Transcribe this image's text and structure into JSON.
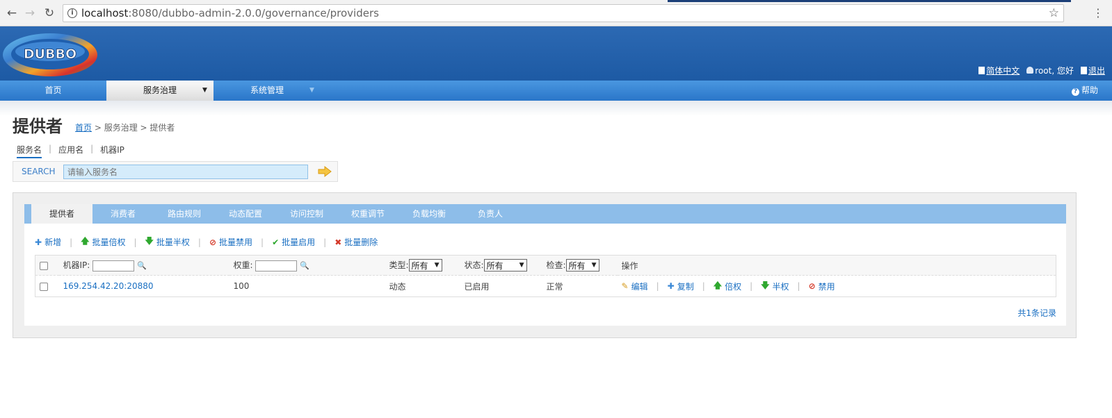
{
  "browser": {
    "url_host": "localhost",
    "url_rest": ":8080/dubbo-admin-2.0.0/governance/providers"
  },
  "header": {
    "logo_text": "DUBBO",
    "lang_label": "简体中文",
    "greeting": "root, 您好",
    "logout_label": "退出",
    "help_label": "帮助"
  },
  "nav": {
    "items": [
      "首页",
      "服务治理",
      "系统管理"
    ]
  },
  "page": {
    "title": "提供者",
    "breadcrumb": {
      "home": "首页",
      "rest": " > 服务治理 > 提供者"
    }
  },
  "search": {
    "tabs": [
      "服务名",
      "应用名",
      "机器IP"
    ],
    "label": "SEARCH",
    "placeholder": "请输入服务名"
  },
  "subtabs": [
    "提供者",
    "消费者",
    "路由规则",
    "动态配置",
    "访问控制",
    "权重调节",
    "负载均衡",
    "负责人"
  ],
  "actions": [
    "新增",
    "批量倍权",
    "批量半权",
    "批量禁用",
    "批量启用",
    "批量删除"
  ],
  "table": {
    "headers": {
      "ip": "机器IP:",
      "weight": "权重:",
      "type": "类型:",
      "status": "状态:",
      "check": "检查:",
      "ops": "操作"
    },
    "filters": {
      "type": "所有",
      "status": "所有",
      "check": "所有"
    },
    "rows": [
      {
        "ip": "169.254.42.20:20880",
        "weight": "100",
        "type": "动态",
        "status": "已启用",
        "check": "正常",
        "ops": [
          "编辑",
          "复制",
          "倍权",
          "半权",
          "禁用"
        ]
      }
    ]
  },
  "footer": {
    "count_text": "共1条记录"
  },
  "colors": {
    "header": "#2c69b3",
    "nav": "#3a86d6",
    "subtabs": "#8dbde9",
    "link": "#1a6fc2",
    "ok": "#2a8f2a"
  }
}
